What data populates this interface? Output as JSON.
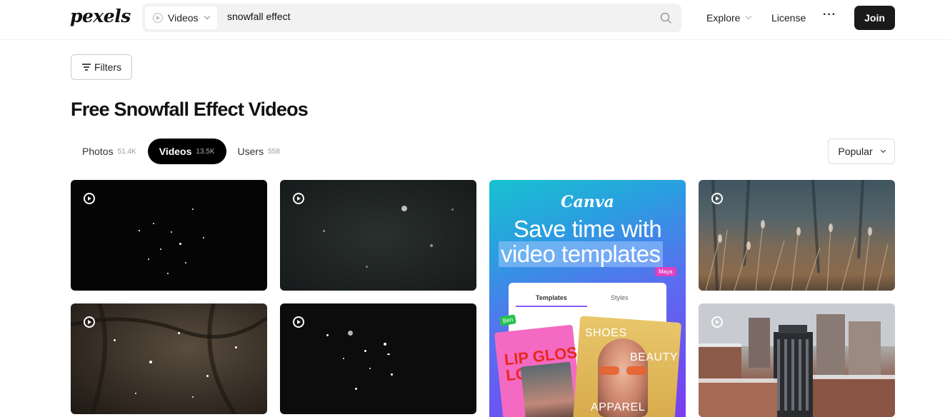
{
  "header": {
    "logo": "pexels",
    "search_type": "Videos",
    "search_value": "snowfall effect",
    "nav_explore": "Explore",
    "nav_license": "License",
    "nav_more": "···",
    "join_label": "Join"
  },
  "filters_label": "Filters",
  "page_title": "Free Snowfall Effect Videos",
  "tabs": [
    {
      "label": "Photos",
      "count": "51.4K"
    },
    {
      "label": "Videos",
      "count": "13.5K"
    },
    {
      "label": "Users",
      "count": "558"
    }
  ],
  "sort_label": "Popular",
  "ad": {
    "brand": "Canva",
    "headline_1": "Save time with",
    "headline_2": "video templates",
    "tag_maya": "Maya",
    "tab_templates": "Templates",
    "tab_styles": "Styles",
    "tag_ben": "Ben",
    "pink_text": "LIP GLOS\nLO",
    "gold_1": "SHOES",
    "gold_2": "BEAUTY",
    "gold_3": "APPAREL"
  },
  "colors": {
    "join_bg": "#1a1a1a",
    "active_tab_bg": "#000000",
    "search_bg": "#f2f2f2"
  }
}
